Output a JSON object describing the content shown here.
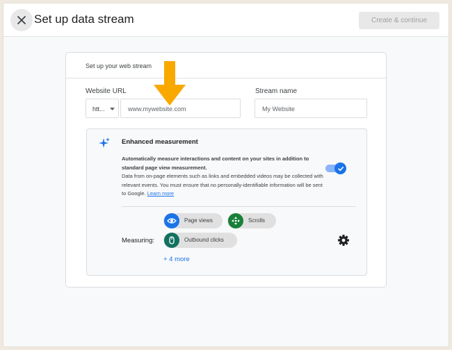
{
  "header": {
    "title": "Set up data stream",
    "primary_label": "Create & continue"
  },
  "card": {
    "title": "Set up your web stream",
    "website_url": {
      "label": "Website URL",
      "protocol": "htt...",
      "placeholder": "www.mywebsite.com"
    },
    "stream_name": {
      "label": "Stream name",
      "placeholder": "My Website"
    }
  },
  "enhanced": {
    "title": "Enhanced measurement",
    "desc_bold": "Automatically measure interactions and content on your sites in addition to standard page view measurement.",
    "desc_rest": "Data from on-page elements such as links and embedded videos may be collected with relevant events. You must ensure that no personally-identifiable information will be sent to Google.",
    "learn_more": "Learn more",
    "toggle_on": true,
    "measuring_label": "Measuring:",
    "chips": [
      {
        "label": "Page views",
        "icon": "eye-icon",
        "color": "#1a73e8"
      },
      {
        "label": "Scrolls",
        "icon": "crosshair-icon",
        "color": "#188038"
      },
      {
        "label": "Outbound clicks",
        "icon": "mouse-icon",
        "color": "#12705e"
      }
    ],
    "more_link": "+ 4 more"
  },
  "colors": {
    "accent": "#1a73e8",
    "arrow": "#f9a800"
  }
}
